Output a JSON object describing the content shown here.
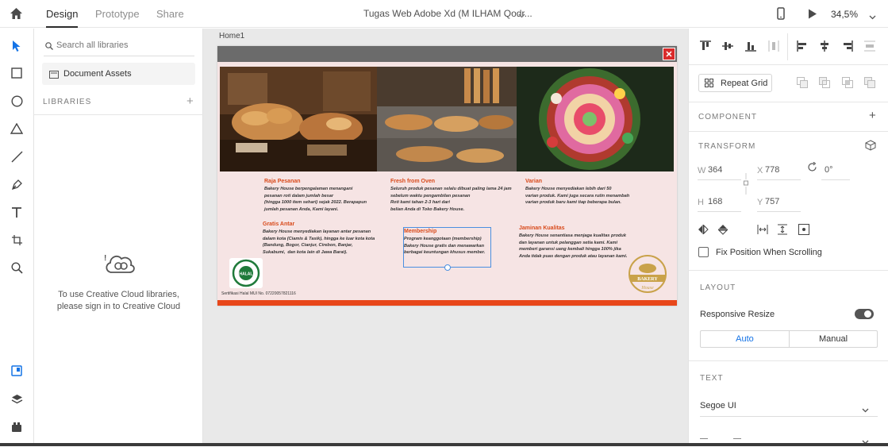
{
  "topbar": {
    "tabs": [
      "Design",
      "Prototype",
      "Share"
    ],
    "active_tab": "Design",
    "document_title": "Tugas Web Adobe Xd  (M ILHAM Qodr...",
    "zoom": "34,5%"
  },
  "libraries": {
    "search_placeholder": "Search all libraries",
    "document_assets": "Document Assets",
    "libraries_header": "LIBRARIES",
    "signin_line1": "To use Creative Cloud libraries,",
    "signin_line2": "please sign in to Creative Cloud"
  },
  "canvas": {
    "artboard_name": "Home1",
    "close_glyph": "✕",
    "features": [
      {
        "title": "Raja Pesanan",
        "body": "Bakery House berpengalaman menangani\npesanan roti dalam jumlah besar\n(hingga 1000 item sehari) sejak 2022. Berapapun\njumlah pesanan Anda, Kami layani."
      },
      {
        "title": "Fresh from Oven",
        "body": "Seluruh produk pesanan selalu dibuat paling lama 24 jam\nsebelum waktu pengambilan pesanan\nRoti kami tahan 2-3 hari dari\nbelian Anda di Toko Bakery House."
      },
      {
        "title": "Varian",
        "body": "Bakery House menyediakan lebih dari 50\nvarian produk. Kami juga secara rutin menambah\nvarian produk baru kami tiap beberapa bulan."
      },
      {
        "title": "Gratis Antar",
        "body": "Bakery House menyediakan layanan antar pesanan\ndalam kota (Ciamis & Tasik), hingga ke luar kota kota\n(Bandung, Bogor, Cianjur, Cirebon, Banjar,\nSukabumi,  dan kota lain di Jawa Barat)."
      },
      {
        "title": "Membership",
        "body": "Program keanggotaan (membership)\nBakery House gratis dan menawarkan\nberbagai keuntungan khusus member."
      },
      {
        "title": "Jaminan Kualitas",
        "body": "Bakery House senantiasa menjaga kualitas produk\ndan layanan untuk pelanggan setia kami. Kami\nmemberi garansi uang kembali hingga 100% jika\nAnda tidak puas dengan produk atau layanan kami."
      }
    ],
    "halal_caption": "Sertifikasi Halal MUI No. 07220057821116",
    "halal_logo_text": "HALAL",
    "bakery_logo_text": "BAKERY",
    "bakery_logo_sub": "House"
  },
  "properties": {
    "repeat_grid": "Repeat Grid",
    "component_header": "COMPONENT",
    "transform_header": "TRANSFORM",
    "w_label": "W",
    "w": "364",
    "x_label": "X",
    "x": "778",
    "rotation": "0°",
    "h_label": "H",
    "h": "168",
    "y_label": "Y",
    "y": "757",
    "fix_position": "Fix Position When Scrolling",
    "layout_header": "LAYOUT",
    "responsive_resize": "Responsive Resize",
    "auto": "Auto",
    "manual": "Manual",
    "text_header": "TEXT",
    "font": "Segoe UI"
  },
  "colors": {
    "accent_blue": "#1473e6",
    "artboard_bg": "#f6e4e4",
    "heading_orange": "#d84a1b",
    "close_red": "#d92b2b",
    "bottom_bar": "#e8471a"
  }
}
